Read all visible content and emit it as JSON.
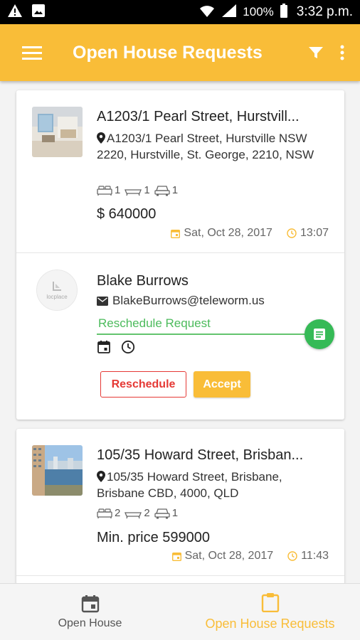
{
  "status_bar": {
    "battery": "100%",
    "time": "3:32 p.m."
  },
  "app_bar": {
    "title": "Open House Requests"
  },
  "listings": [
    {
      "title": "A1203/1 Pearl Street, Hurstvill...",
      "address": "A1203/1 Pearl Street, Hurstville NSW 2220, Hurstville, St. George, 2210, NSW",
      "bedrooms": "1",
      "bathrooms": "1",
      "parking": "1",
      "price": "$ 640000",
      "date": "Sat, Oct 28, 2017",
      "time": "13:07",
      "requester": {
        "avatar_text": "locplace",
        "name": "Blake Burrows",
        "email": "BlakeBurrows@teleworm.us",
        "request_label": "Reschedule Request",
        "reschedule_label": "Reschedule",
        "accept_label": "Accept"
      }
    },
    {
      "title": "105/35 Howard Street, Brisban...",
      "address": "105/35 Howard Street, Brisbane, Brisbane CBD, 4000, QLD",
      "bedrooms": "2",
      "bathrooms": "2",
      "parking": "1",
      "price": "Min. price 599000",
      "date": "Sat, Oct 28, 2017",
      "time": "11:43"
    }
  ],
  "bottom_nav": {
    "items": [
      {
        "label": "Open House",
        "icon": "calendar-icon",
        "active": false
      },
      {
        "label": "Open House Requests",
        "icon": "clipboard-icon",
        "active": true
      }
    ]
  },
  "colors": {
    "accent": "#f9bd38",
    "success": "#35ba56",
    "danger": "#e53935"
  }
}
